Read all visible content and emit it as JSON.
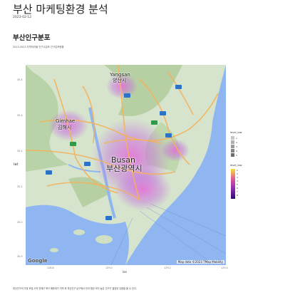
{
  "header": {
    "title": "부산 마케팅환경 분석",
    "date": "2023-02-12"
  },
  "section": {
    "title": "부산인구분포",
    "subtitle": "2013-2023 지역저라별 인구수분포 인구분포현황"
  },
  "map": {
    "labels": {
      "yangsan": "Yangsan",
      "yangsan_kr": "양산시",
      "gimhae": "Gimhae",
      "gimhae_kr": "김해시",
      "busan": "Busan",
      "busan_kr": "부산광역시"
    },
    "credit": "Map data ©2023 TMap Mobility",
    "google": "Google"
  },
  "axes": {
    "ylabel": "lat",
    "xlabel": "lon",
    "y_ticks": [
      "35.4",
      "35.3",
      "35.2",
      "35.1",
      "35.0",
      "34.9"
    ],
    "x_ticks": [
      "128.8",
      "129.0",
      "129.2",
      "129.4"
    ]
  },
  "legend": {
    "level_low_title": "level_low",
    "level_low_items": [
      "1",
      "2",
      "3",
      "4",
      "5"
    ],
    "level_title": "level_low",
    "level_items": [
      "1",
      "2",
      "3",
      "4",
      "5",
      "6",
      "7",
      "8"
    ]
  },
  "caption": "부산인구의 가장 조밀 사직 연제구 북구 해운대구 지역 와 부산진구 남구에서 전국 평균 보다 높은 인구가 결집되 있음을 볼 수 있다.",
  "colors": {
    "sea": "#8fb6f0",
    "land": "#cfe0c4",
    "road": "#f5b45a",
    "gradient_low": "#2b0a6b",
    "gradient_high": "#f4e23a"
  }
}
